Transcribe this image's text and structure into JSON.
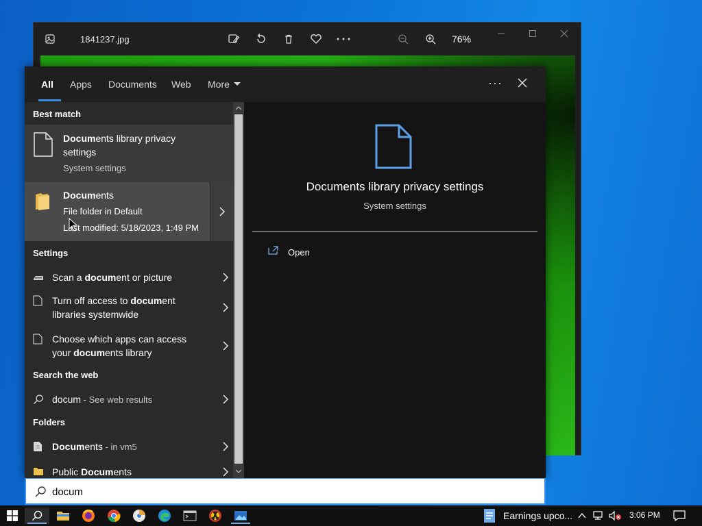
{
  "photos": {
    "filename": "1841237.jpg",
    "zoom": "76%"
  },
  "tabs": [
    {
      "label": "All",
      "active": true
    },
    {
      "label": "Apps"
    },
    {
      "label": "Documents"
    },
    {
      "label": "Web"
    },
    {
      "label": "More"
    }
  ],
  "sections": {
    "best_match": "Best match",
    "settings": "Settings",
    "search_web": "Search the web",
    "folders": "Folders"
  },
  "best_match": [
    {
      "title_bold": "Docum",
      "title_rest": "ents library privacy",
      "title_line2": "settings",
      "subtitle": "System settings"
    },
    {
      "title_bold": "Docum",
      "title_rest": "ents",
      "subtitle": "File folder in Default",
      "meta": "Last modified: 5/18/2023, 1:49 PM"
    }
  ],
  "settings_items": [
    {
      "pre": "Scan a ",
      "bold": "docum",
      "post": "ent or picture"
    },
    {
      "pre": "Turn off access to ",
      "bold": "docum",
      "post": "ent",
      "line2": "libraries systemwide"
    },
    {
      "pre": "Choose which apps can access",
      "line2_pre": "your ",
      "line2_bold": "docum",
      "line2_post": "ents library"
    }
  ],
  "web_item": {
    "query": "docum",
    "suffix": " - See web results"
  },
  "folders_items": [
    {
      "bold": "Docum",
      "rest": "ents",
      "suffix": " - in vm5"
    },
    {
      "pre": "Public ",
      "bold": "Docum",
      "rest": "ents"
    }
  ],
  "preview": {
    "title": "Documents library privacy settings",
    "subtitle": "System settings",
    "action": "Open"
  },
  "search": {
    "value": "docum"
  },
  "taskbar": {
    "news": "Earnings upco...",
    "time": "3:06 PM"
  },
  "colors": {
    "accent": "#3a8ee6",
    "panel": "#1f1f1f",
    "list_bg": "#2a2a2a"
  }
}
